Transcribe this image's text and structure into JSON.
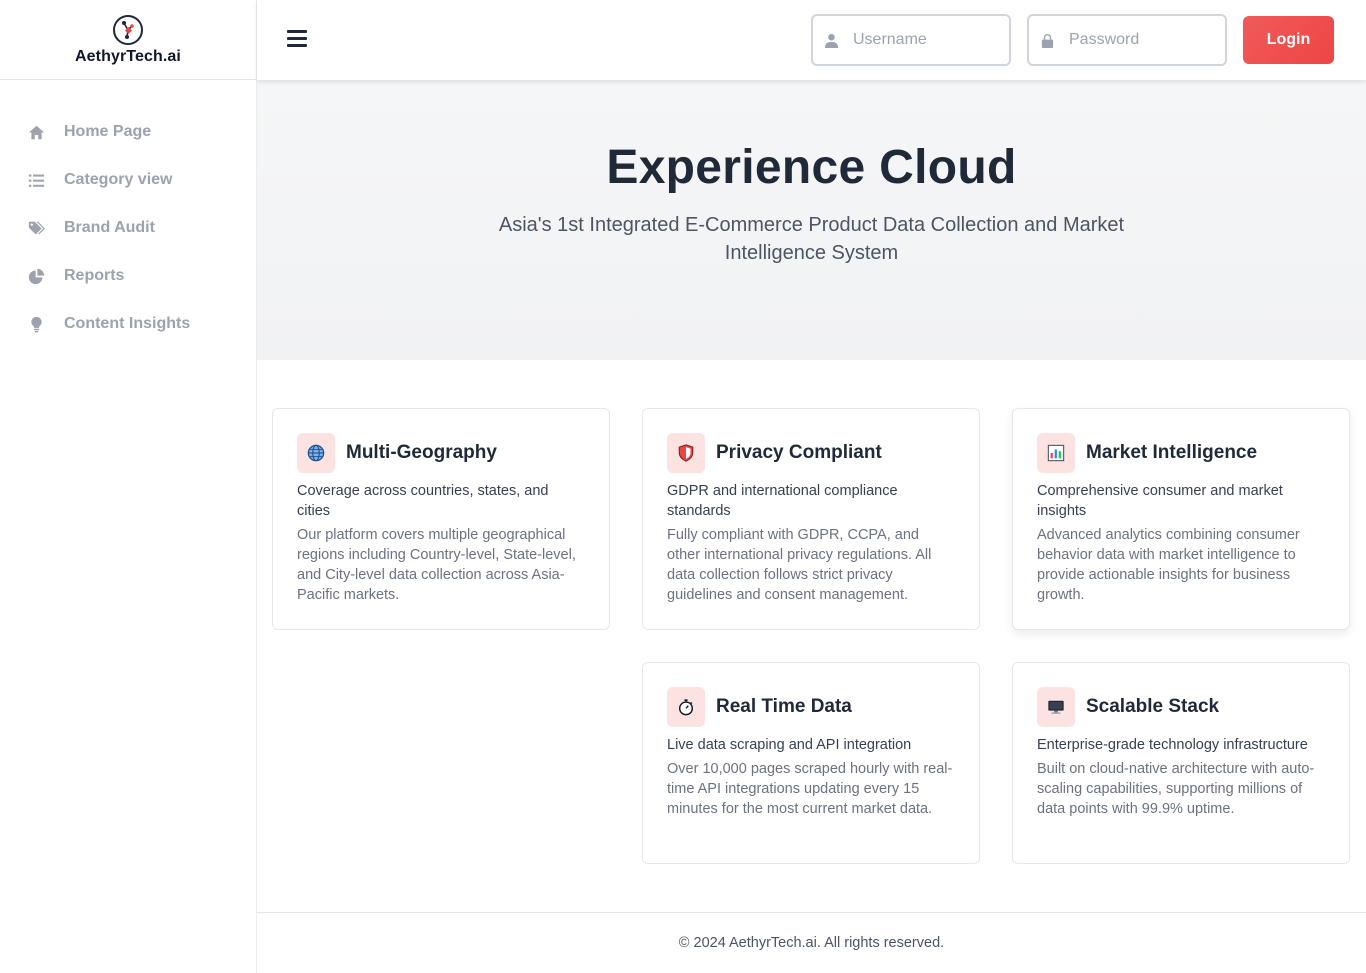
{
  "brand": {
    "name": "AethyrTech.ai"
  },
  "sidebar": {
    "items": [
      {
        "label": "Home Page",
        "icon": "home-icon"
      },
      {
        "label": "Category view",
        "icon": "list-icon"
      },
      {
        "label": "Brand Audit",
        "icon": "tags-icon"
      },
      {
        "label": "Reports",
        "icon": "pie-chart-icon"
      },
      {
        "label": "Content Insights",
        "icon": "lightbulb-icon"
      }
    ]
  },
  "header": {
    "username_placeholder": "Username",
    "password_placeholder": "Password",
    "login_label": "Login"
  },
  "hero": {
    "title": "Experience Cloud",
    "subtitle": "Asia's 1st Integrated E-Commerce Product Data Collection and Market Intelligence System"
  },
  "cards": [
    {
      "title": "Multi-Geography",
      "icon": "globe-icon",
      "lead": "Coverage across countries, states, and cities",
      "desc": "Our platform covers multiple geographical regions including Country-level, State-level, and City-level data collection across Asia-Pacific markets."
    },
    {
      "title": "Privacy Compliant",
      "icon": "shield-icon",
      "lead": "GDPR and international compliance standards",
      "desc": "Fully compliant with GDPR, CCPA, and other international privacy regulations. All data collection follows strict privacy guidelines and consent management."
    },
    {
      "title": "Market Intelligence",
      "icon": "bar-chart-icon",
      "lead": "Comprehensive consumer and market insights",
      "desc": "Advanced analytics combining consumer behavior data with market intelligence to provide actionable insights for business growth."
    },
    {
      "title": "Real Time Data",
      "icon": "stopwatch-icon",
      "lead": "Live data scraping and API integration",
      "desc": "Over 10,000 pages scraped hourly with real-time API integrations updating every 15 minutes for the most current market data."
    },
    {
      "title": "Scalable Stack",
      "icon": "monitor-icon",
      "lead": "Enterprise-grade technology infrastructure",
      "desc": "Built on cloud-native architecture with auto-scaling capabilities, supporting millions of data points with 99.9% uptime."
    }
  ],
  "footer": {
    "text": "© 2024 AethyrTech.ai. All rights reserved."
  },
  "colors": {
    "accent": "#ef4444",
    "icon_bg": "#fde2e2",
    "nav_text": "#9ca3af"
  }
}
